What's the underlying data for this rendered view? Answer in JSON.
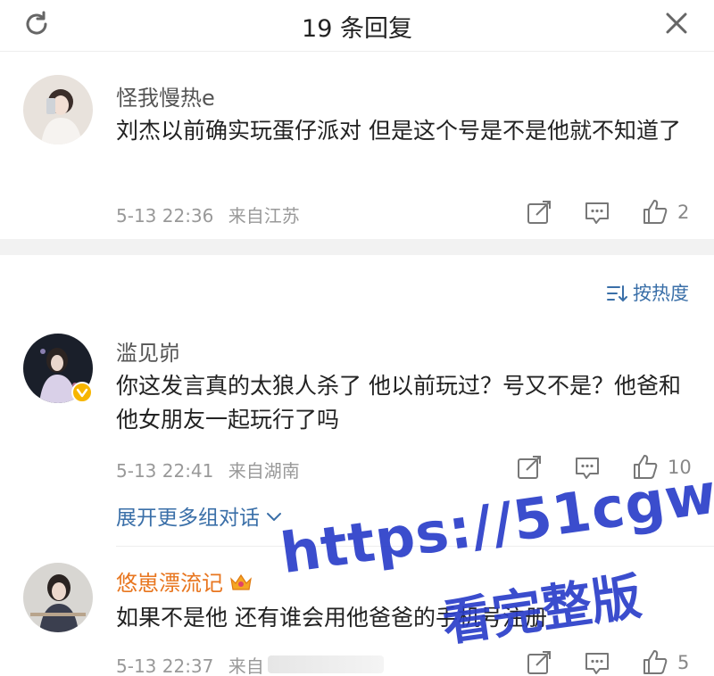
{
  "header": {
    "title": "19 条回复"
  },
  "colors": {
    "link": "#3a6fa8",
    "vip_name": "#e8761f",
    "watermark": "#2b3ec9"
  },
  "main_comment": {
    "username": "怪我慢热e",
    "text": "刘杰以前确实玩蛋仔派对 但是这个号是不是他就不知道了",
    "time": "5-13 22:36",
    "location": "来自江苏",
    "likes": "2"
  },
  "sort": {
    "label": "按热度"
  },
  "replies": [
    {
      "username": "滥见峁",
      "verified": true,
      "text": "你这发言真的太狼人杀了 他以前玩过？号又不是？他爸和他女朋友一起玩行了吗",
      "time": "5-13 22:41",
      "location": "来自湖南",
      "likes": "10"
    },
    {
      "username": "悠崽漂流记",
      "vip": true,
      "text": "如果不是他 还有谁会用他爸爸的手机号注册",
      "time": "5-13 22:37",
      "location": "来自",
      "likes": "5"
    }
  ],
  "expand": {
    "label": "展开更多组对话"
  },
  "watermark": {
    "url": "https://51cgw.pro",
    "subtitle": "看完整版"
  },
  "icons": [
    "refresh-icon",
    "close-icon",
    "share-icon",
    "comment-icon",
    "like-icon",
    "sort-icon",
    "chevron-down-icon",
    "verified-icon",
    "crown-icon"
  ]
}
